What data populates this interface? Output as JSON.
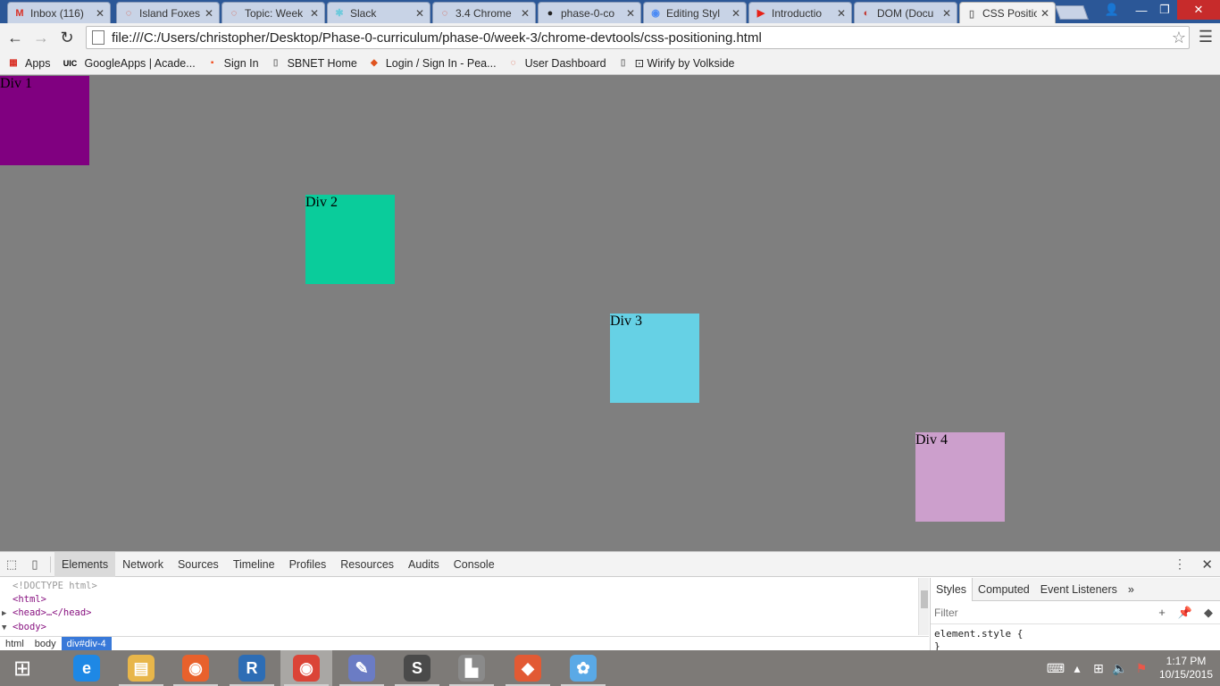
{
  "tabs": [
    {
      "label": "Inbox (116)",
      "icon": "gmail-icon",
      "glyph": "M",
      "color": "#d93025"
    },
    {
      "label": "Island Foxes",
      "icon": "devbootcamp-icon",
      "glyph": "◌",
      "color": "#d84a2f"
    },
    {
      "label": "Topic: Week",
      "icon": "devbootcamp-icon",
      "glyph": "◌",
      "color": "#d84a2f"
    },
    {
      "label": "Slack",
      "icon": "slack-icon",
      "glyph": "✱",
      "color": "#6ecadc"
    },
    {
      "label": "3.4 Chrome",
      "icon": "devbootcamp-icon",
      "glyph": "◌",
      "color": "#d84a2f"
    },
    {
      "label": "phase-0-co",
      "icon": "github-icon",
      "glyph": "●",
      "color": "#222222"
    },
    {
      "label": "Editing Styl",
      "icon": "chrome-icon",
      "glyph": "◉",
      "color": "#4c8bf5"
    },
    {
      "label": "Introductio",
      "icon": "youtube-icon",
      "glyph": "▶",
      "color": "#e62117"
    },
    {
      "label": "DOM (Docu",
      "icon": "mdn-icon",
      "glyph": "◐",
      "color": "#c13832"
    },
    {
      "label": "CSS Positio",
      "icon": "page-icon",
      "glyph": "▯",
      "color": "#777777"
    }
  ],
  "toolbar": {
    "url": "file:///C:/Users/christopher/Desktop/Phase-0-curriculum/phase-0/week-3/chrome-devtools/css-positioning.html"
  },
  "bookmarks": [
    {
      "label": "Apps",
      "icon": "apps-grid-icon",
      "glyph": "▦",
      "color": "#d93025"
    },
    {
      "label": "GoogleApps | Acade...",
      "icon": "uic-icon",
      "glyph": "UIC",
      "color": "#000000"
    },
    {
      "label": "Sign In",
      "icon": "windows-logo-icon",
      "glyph": "▪",
      "color": "#f25022"
    },
    {
      "label": "SBNET Home",
      "icon": "page-icon",
      "glyph": "▯",
      "color": "#777777"
    },
    {
      "label": "Login / Sign In - Pea...",
      "icon": "pearson-icon",
      "glyph": "◆",
      "color": "#e0541f"
    },
    {
      "label": "User Dashboard",
      "icon": "devbootcamp-icon",
      "glyph": "◌",
      "color": "#d84a2f"
    },
    {
      "label": "⊡ Wirify by Volkside",
      "icon": "page-icon",
      "glyph": "▯",
      "color": "#777777"
    }
  ],
  "page": {
    "boxes": [
      {
        "label": "Div 1",
        "color": "#800080"
      },
      {
        "label": "Div 2",
        "color": "#0acc9b"
      },
      {
        "label": "Div 3",
        "color": "#66d1e5"
      },
      {
        "label": "Div 4",
        "color": "#cc9fcc"
      }
    ]
  },
  "devtools": {
    "tabs": [
      "Elements",
      "Network",
      "Sources",
      "Timeline",
      "Profiles",
      "Resources",
      "Audits",
      "Console"
    ],
    "active_tab": "Elements",
    "dom": [
      {
        "text": "<!DOCTYPE html>",
        "kind": "doctype",
        "tri": ""
      },
      {
        "text": "<html>",
        "kind": "tag",
        "tri": ""
      },
      {
        "text": "<head>…</head>",
        "kind": "tag",
        "tri": "▶"
      },
      {
        "text": "<body>",
        "kind": "tag",
        "tri": "▼"
      }
    ],
    "breadcrumbs": [
      "html",
      "body",
      "div#div-4"
    ],
    "styles_tabs": [
      "Styles",
      "Computed",
      "Event Listeners",
      "»"
    ],
    "filter_placeholder": "Filter",
    "rule_selector": "element.style {",
    "rule_close": "}"
  },
  "taskbar": {
    "apps": [
      {
        "name": "internet-explorer-icon",
        "glyph": "e",
        "color": "#1e88e5"
      },
      {
        "name": "file-explorer-icon",
        "glyph": "▤",
        "color": "#e8b64a"
      },
      {
        "name": "firefox-icon",
        "glyph": "◉",
        "color": "#e8612c"
      },
      {
        "name": "r-icon",
        "glyph": "R",
        "color": "#2d6db5"
      },
      {
        "name": "chrome-icon",
        "glyph": "◉",
        "color": "#db4437"
      },
      {
        "name": "notepad-icon",
        "glyph": "✎",
        "color": "#6b7cc4"
      },
      {
        "name": "sublime-icon",
        "glyph": "S",
        "color": "#4a4a4a"
      },
      {
        "name": "castle-icon",
        "glyph": "▙",
        "color": "#8a8a8a"
      },
      {
        "name": "git-icon",
        "glyph": "◆",
        "color": "#e25a34"
      },
      {
        "name": "paint-icon",
        "glyph": "✿",
        "color": "#5aa9e6"
      }
    ],
    "time": "1:17 PM",
    "date": "10/15/2015"
  }
}
